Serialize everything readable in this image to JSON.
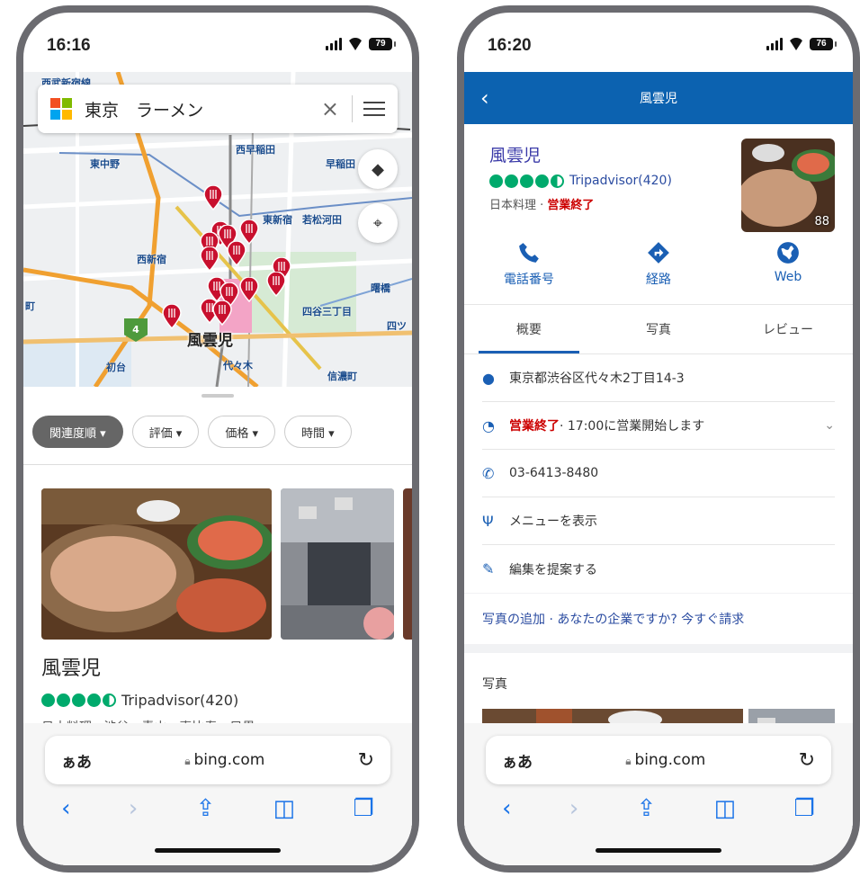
{
  "left": {
    "status": {
      "time": "16:16",
      "battery": "79"
    },
    "search": {
      "query": "東京　ラーメン"
    },
    "map": {
      "labels": [
        "西武新宿線",
        "西早稲田",
        "東中野",
        "早稲田",
        "西新宿",
        "東新宿",
        "若松河田",
        "曙橋",
        "四谷三丁目",
        "四ツ",
        "初台",
        "代々木",
        "信濃町",
        "町",
        "西新宿",
        "新宿線"
      ],
      "route_shield": "4",
      "selected_pin_label": "風雲児"
    },
    "chips": [
      "関連度順 ▾",
      "評価 ▾",
      "価格 ▾",
      "時間 ▾"
    ],
    "result": {
      "name": "風雲児",
      "rating_source": "Tripadvisor(420)",
      "meta": "日本料理 · 渋谷、青山、恵比寿、目黒"
    },
    "safari": {
      "aa": "ぁあ",
      "url": "bing.com"
    }
  },
  "right": {
    "status": {
      "time": "16:20",
      "battery": "76"
    },
    "header": {
      "title": "風雲児",
      "back": "‹"
    },
    "place": {
      "name": "風雲児",
      "rating_source": "Tripadvisor(420)",
      "category": "日本料理",
      "state": "営業終了",
      "photo_count": "88"
    },
    "actions": [
      "電話番号",
      "経路",
      "Web"
    ],
    "tabs": [
      "概要",
      "写真",
      "レビュー"
    ],
    "address": "東京都渋谷区代々木2丁目14-3",
    "hours_state": "営業終了",
    "hours_note": " · 17:00に営業開始します",
    "phone": "03-6413-8480",
    "menu": "メニューを表示",
    "suggest": "編集を提案する",
    "links": "写真の追加 · あなたの企業ですか? 今すぐ請求",
    "photos_heading": "写真",
    "safari": {
      "aa": "ぁあ",
      "url": "bing.com"
    }
  },
  "colors": {
    "bing_blue": "#0c62b0",
    "tripadvisor_green": "#00aa6c",
    "closed_red": "#cc0000",
    "pin_red": "#c8102e"
  }
}
